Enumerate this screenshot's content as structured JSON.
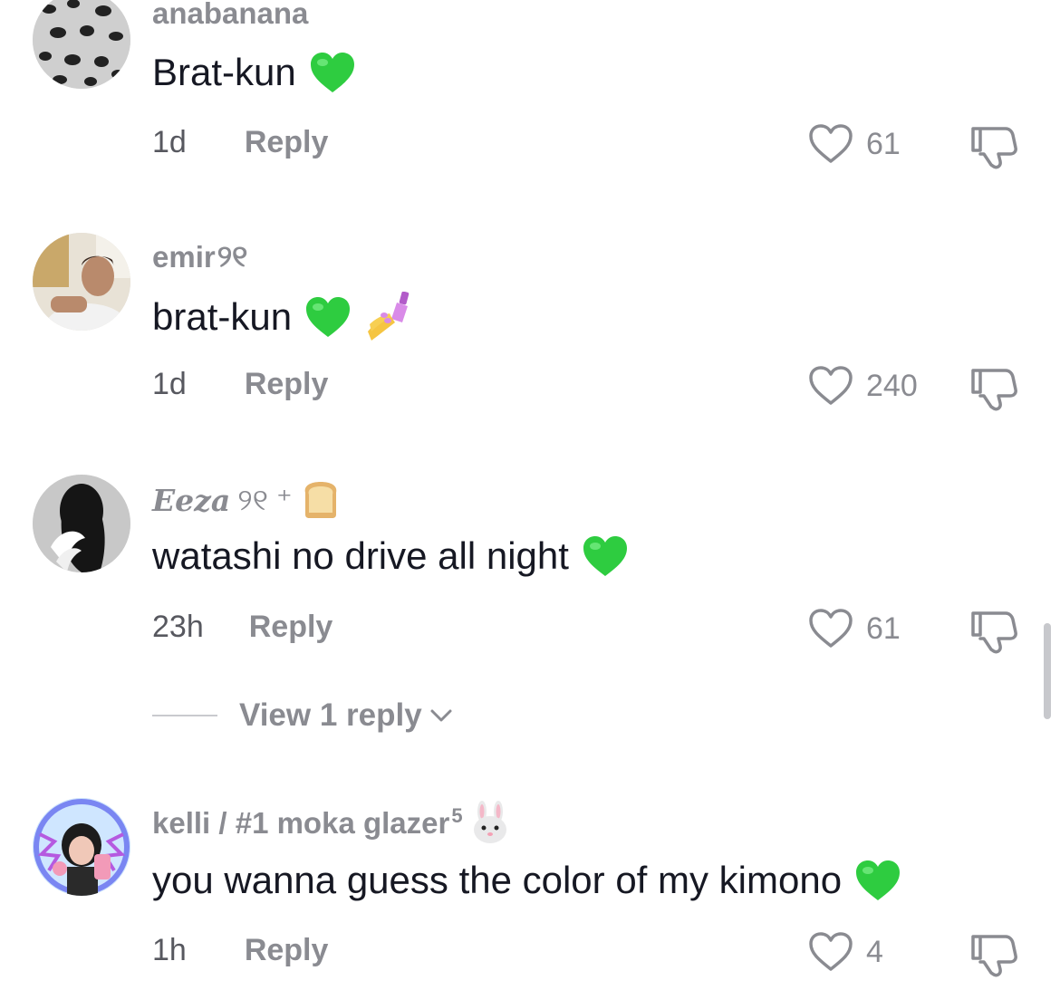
{
  "comments": [
    {
      "username": "anabanana",
      "username_suffix": "",
      "text": "Brat-kun",
      "time": "1d",
      "reply_label": "Reply",
      "likes": "61",
      "emojis": [
        "green-heart-icon"
      ]
    },
    {
      "username": "emir",
      "username_suffix": "୨୧",
      "text": "brat-kun",
      "time": "1d",
      "reply_label": "Reply",
      "likes": "240",
      "emojis": [
        "green-heart-icon",
        "nail-polish-icon"
      ]
    },
    {
      "username": "Eeza",
      "username_suffix": "୨୧ ⁺",
      "text": "watashi no drive all night",
      "time": "23h",
      "reply_label": "Reply",
      "likes": "61",
      "emojis": [
        "green-heart-icon"
      ],
      "view_replies": "View 1 reply"
    },
    {
      "username": "kelli / #1 moka glazer",
      "username_sup": "5",
      "text": "you wanna guess the color of my kimono",
      "time": "1h",
      "reply_label": "Reply",
      "likes": "4",
      "emojis": [
        "green-heart-icon"
      ]
    }
  ],
  "colors": {
    "text": "#161823",
    "muted": "#8a8b91",
    "heart_green": "#2ecc40"
  }
}
